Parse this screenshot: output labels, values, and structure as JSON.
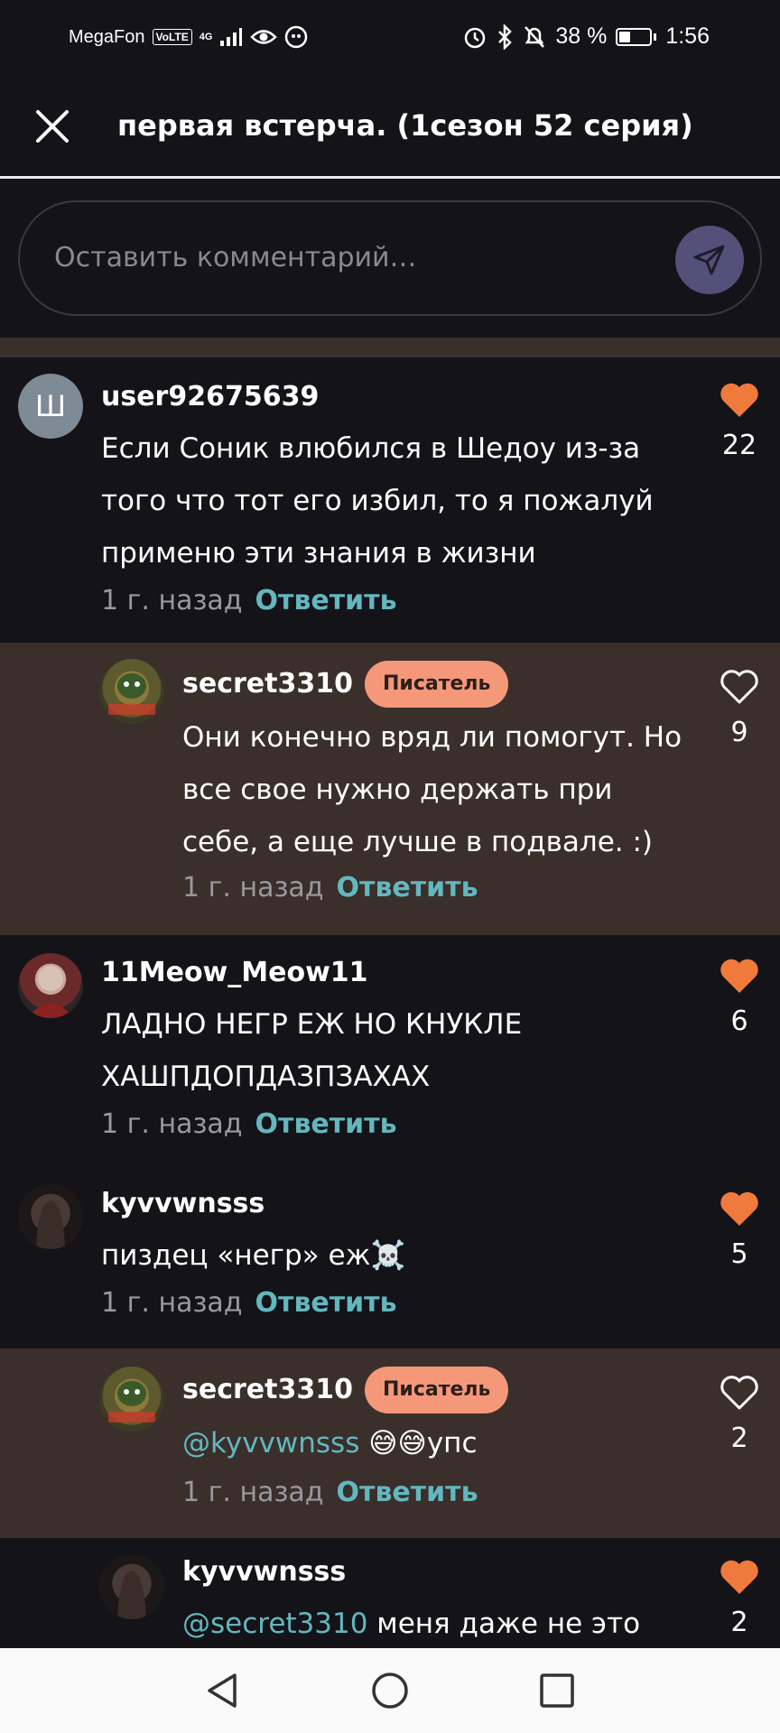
{
  "status_bar": {
    "carrier": "MegaFon",
    "volte": "VoLTE",
    "network": "4G",
    "battery": "38 %",
    "battery_level": 0.38,
    "time": "1:56"
  },
  "header": {
    "title": "первая встерча. (1сезон 52 серия)",
    "close_icon": "close-icon"
  },
  "composer": {
    "placeholder": "Оставить комментарий…",
    "send_icon": "send-icon",
    "send_color": "#55507a"
  },
  "colors": {
    "background": "#141318",
    "reply_background": "#3a2f2b",
    "accent_link": "#63b7bf",
    "heart": "#f07a3c",
    "badge": "#f5987a"
  },
  "comments": [
    {
      "avatar_letter": "Ш",
      "username": "user92675639",
      "text": "Если Соник влюбился в Шедоу из-за того что тот его избил, то я пожалуй применю эти знания в жизни",
      "time": "1 г. назад",
      "reply_label": "Ответить",
      "likes": "22",
      "liked": true
    },
    {
      "username": "secret3310",
      "badge": "Писатель",
      "text": "Они конечно вряд ли помогут. Но все свое нужно держать при себе, а еще лучше в подвале. :)",
      "time": "1 г. назад",
      "reply_label": "Ответить",
      "likes": "9",
      "liked": false
    },
    {
      "username": "11Meow_Meow11",
      "text": "ЛАДНО НЕГР ЕЖ НО КНУКЛЕ ХАШПДОПДАЗПЗАХАХ",
      "time": "1 г. назад",
      "reply_label": "Ответить",
      "likes": "6",
      "liked": true
    },
    {
      "username": "kyvvwnsss",
      "text": "пиздец «негр» еж☠️",
      "time": "1 г. назад",
      "reply_label": "Ответить",
      "likes": "5",
      "liked": true
    },
    {
      "username": "secret3310",
      "badge": "Писатель",
      "mention": "@kyvvwnsss",
      "text": " 😅😅упс",
      "time": "1 г. назад",
      "reply_label": "Ответить",
      "likes": "2",
      "liked": false
    },
    {
      "username": "kyvvwnsss",
      "mention": "@secret3310",
      "text": " меня даже не это",
      "likes": "2",
      "liked": true
    }
  ],
  "navbar": {
    "back_icon": "back-triangle-icon",
    "home_icon": "home-circle-icon",
    "recents_icon": "recents-square-icon"
  }
}
